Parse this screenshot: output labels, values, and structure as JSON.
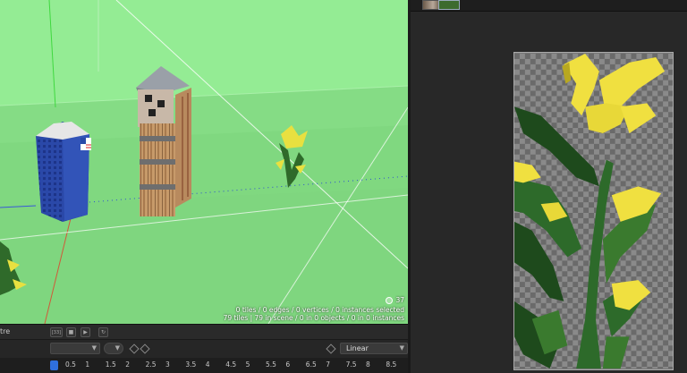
{
  "viewport": {
    "fps": "37",
    "stats_line1": "0 tiles / 0 edges / 0 vertices / 0 instances selected",
    "stats_line2": "79 tiles | 79 in scene / 0 in 0 objects / 0 in 0 instances"
  },
  "timeline": {
    "row1_label": "tre",
    "frame_button": "[33]",
    "interpolation": "Linear",
    "ticks": [
      "0.5",
      "1",
      "1.5",
      "2",
      "2.5",
      "3",
      "3.5",
      "4",
      "4.5",
      "5",
      "5.5",
      "6",
      "6.5",
      "7",
      "7.5",
      "8",
      "8.5"
    ]
  },
  "colors": {
    "sky": "#94ec94",
    "ground": "#85dc85",
    "panel": "#282828",
    "playhead": "#2f6fdc"
  }
}
